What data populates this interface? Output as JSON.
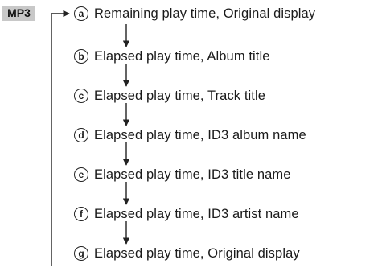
{
  "mode_label": "MP3",
  "items": [
    {
      "letter": "a",
      "text": "Remaining play time, Original display"
    },
    {
      "letter": "b",
      "text": "Elapsed play time, Album title"
    },
    {
      "letter": "c",
      "text": "Elapsed play time, Track title"
    },
    {
      "letter": "d",
      "text": "Elapsed play time, ID3 album name"
    },
    {
      "letter": "e",
      "text": "Elapsed play time, ID3 title name"
    },
    {
      "letter": "f",
      "text": "Elapsed play time, ID3 artist name"
    },
    {
      "letter": "g",
      "text": "Elapsed play time, Original display"
    }
  ],
  "colors": {
    "badge_bg": "#c8c8c8",
    "line": "#222222",
    "text": "#1a1a1a"
  }
}
